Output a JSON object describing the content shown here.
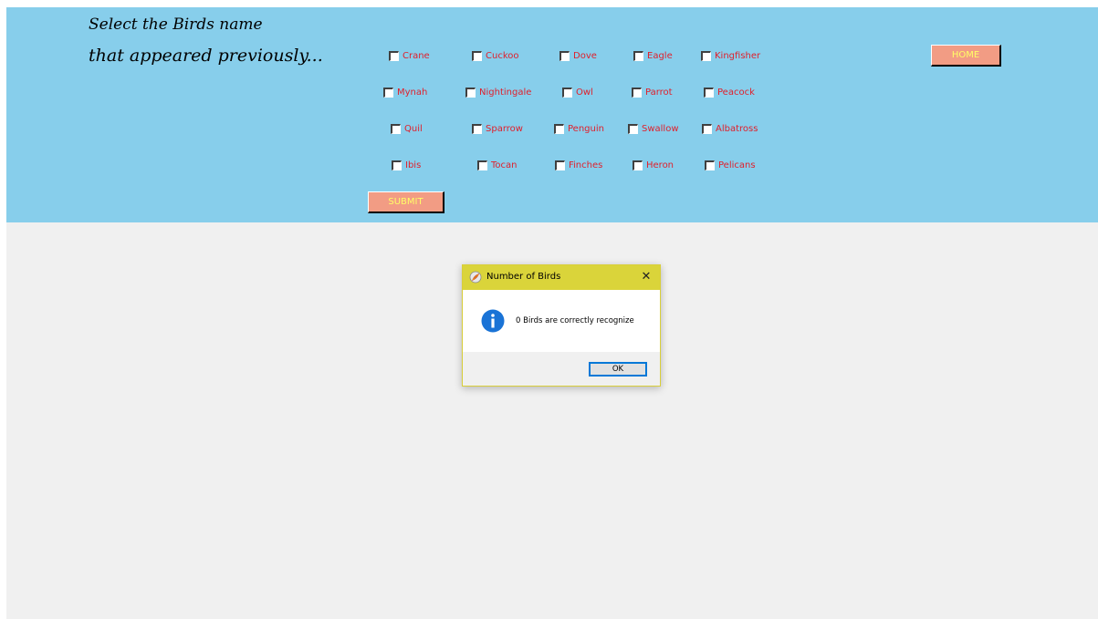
{
  "heading": {
    "line1": "Select the Birds name",
    "line2": "that appeared previously..."
  },
  "birds": {
    "row1": [
      "Crane",
      "Cuckoo",
      "Dove",
      "Eagle",
      "Kingfisher"
    ],
    "row2": [
      "Mynah",
      "Nightingale",
      "Owl",
      "Parrot",
      "Peacock"
    ],
    "row3": [
      "Quil",
      "Sparrow",
      "Penguin",
      "Swallow",
      "Albatross"
    ],
    "row4": [
      "Ibis",
      "Tocan",
      "Finches",
      "Heron",
      "Pelicans"
    ]
  },
  "buttons": {
    "home_label": "HOME",
    "submit_label": "SUBMIT"
  },
  "dialog": {
    "title": "Number of Birds",
    "close_symbol": "✕",
    "message": "0 Birds are correctly recognize",
    "ok_label": "OK",
    "icon": "info-icon"
  },
  "colors": {
    "panel": "#87ceeb",
    "checkbox_text": "#e0202c",
    "button_bg": "#f29c84",
    "button_text": "#ffff66",
    "dialog_titlebar": "#dad43a"
  }
}
